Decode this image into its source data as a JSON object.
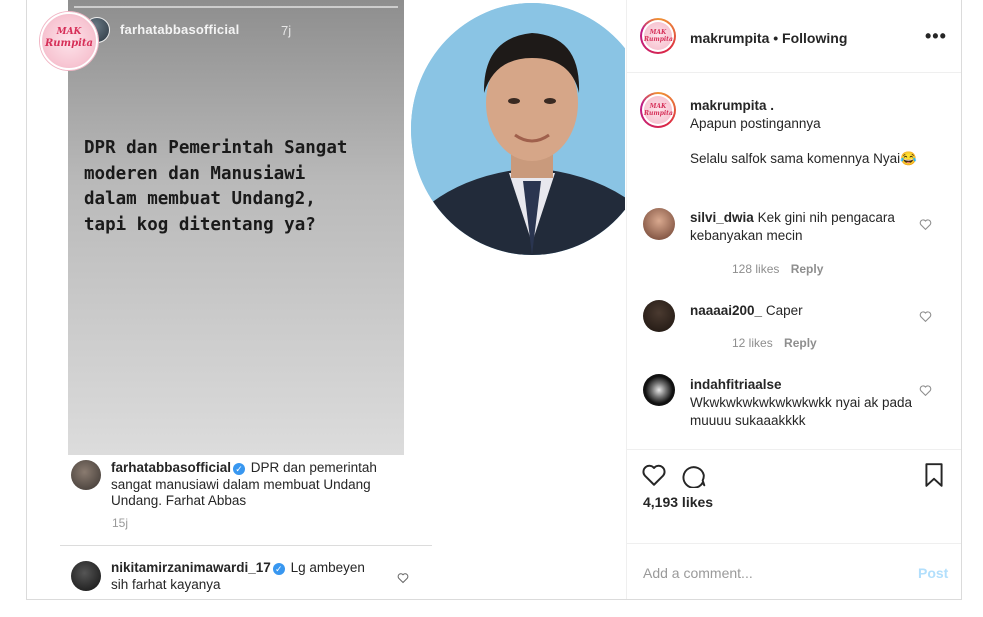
{
  "image": {
    "story": {
      "username": "farhatabbasofficial",
      "time": "7j",
      "text": "DPR dan Pemerintah Sangat\nmoderen dan Manusiawi\ndalam membuat Undang2,\ntapi kog ditentang ya?"
    },
    "brand_logo_text": [
      "MAK",
      "Rumpita"
    ],
    "caption": {
      "username": "farhatabbasofficial",
      "text": "DPR dan pemerintah sangat manusiawi dalam membuat Undang Undang. Farhat Abbas",
      "time": "15j"
    },
    "reply": {
      "username": "nikitamirzanimawardi_17",
      "text": "Lg ambeyen sih farhat kayanya"
    }
  },
  "header": {
    "username": "makrumpita",
    "separator": "•",
    "follow_status": "Following",
    "more": "•••"
  },
  "post": {
    "username": "makrumpita .",
    "line1": "Apapun postingannya",
    "line2": "Selalu salfok sama komennya Nyai😂"
  },
  "comments": [
    {
      "username": "silvi_dwia",
      "text": "Kek gini nih pengacara kebanyakan mecin",
      "likes": "128 likes",
      "reply": "Reply"
    },
    {
      "username": "naaaai200_",
      "text": "Caper",
      "likes": "12 likes",
      "reply": "Reply"
    },
    {
      "username": "indahfitriaalse",
      "text": "Wkwkwkwkwkwkwkwkk nyai ak pada muuuu sukaaakkkk"
    }
  ],
  "likes_count": "4,193 likes",
  "add_comment": {
    "placeholder": "Add a comment...",
    "post_label": "Post"
  }
}
